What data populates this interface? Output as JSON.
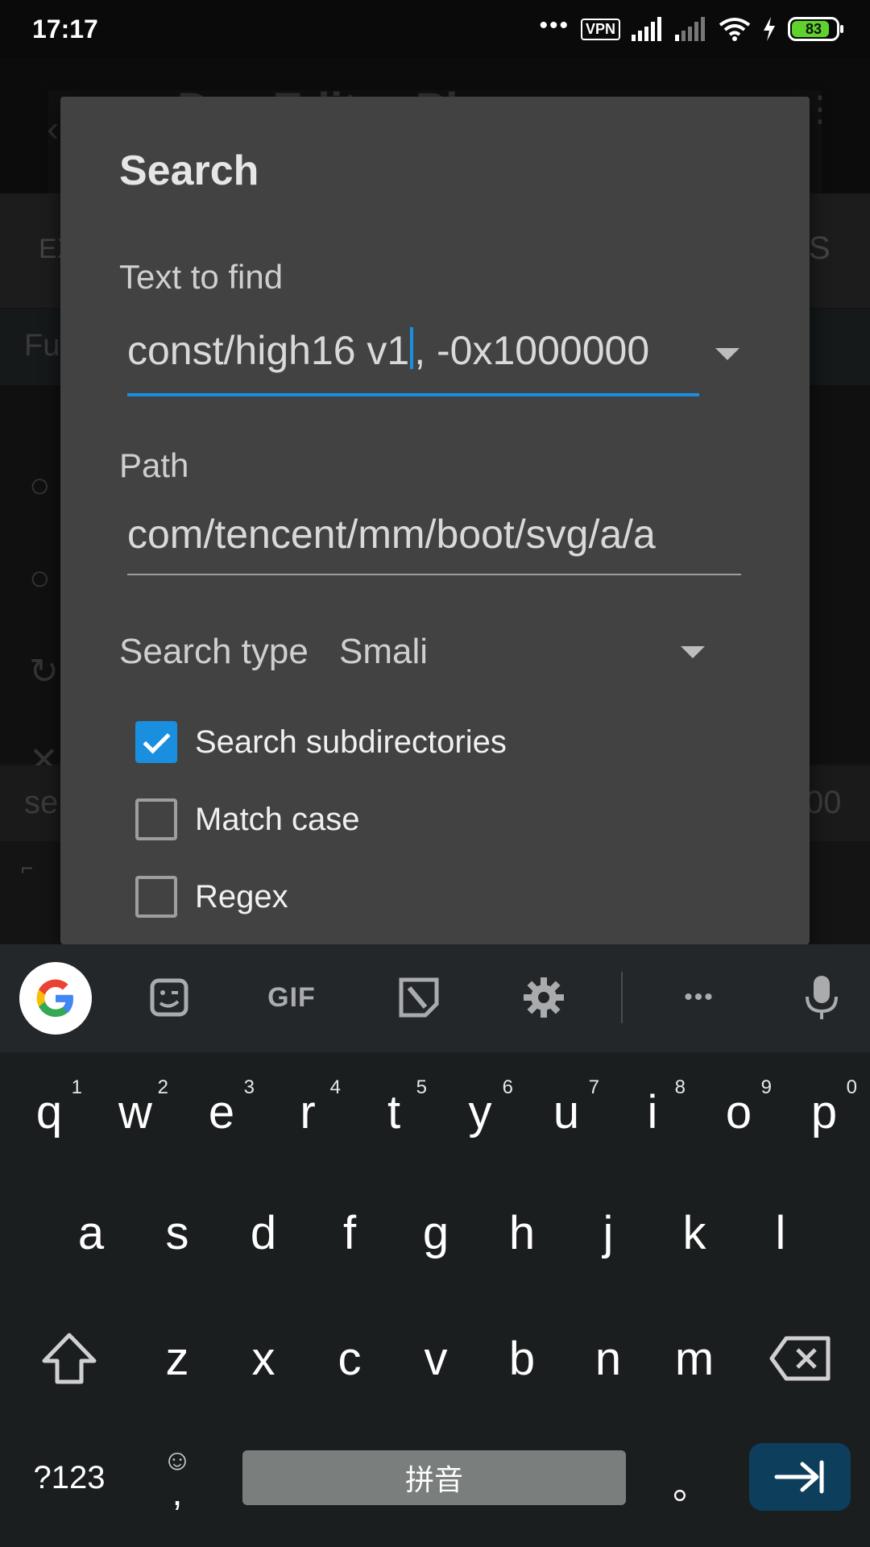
{
  "status_bar": {
    "time": "17:17",
    "dots": "•••",
    "vpn": "VPN",
    "battery": "83",
    "battery_color": "#5fd32b"
  },
  "background_app": {
    "title": "Dex Editor Plus",
    "tab_left": "EX",
    "tab_right": "S",
    "filter_text": "Fu",
    "footer_left": "se",
    "footer_right": "00"
  },
  "dialog": {
    "title": "Search",
    "find_label": "Text to find",
    "find_value_before_caret": "const/high16 v1",
    "find_value_after_caret": ", -0x1000000",
    "path_label": "Path",
    "path_value": "com/tencent/mm/boot/svg/a/a",
    "search_type_label": "Search type",
    "search_type_value": "Smali",
    "checkboxes": [
      {
        "label": "Search subdirectories",
        "checked": true
      },
      {
        "label": "Match case",
        "checked": false
      },
      {
        "label": "Regex",
        "checked": false
      }
    ],
    "accent_color": "#1a8fe0"
  },
  "keyboard": {
    "toolbar_icons": [
      "google-icon",
      "sticker-icon",
      "gif-icon",
      "clipboard-icon",
      "settings-icon",
      "more-icon",
      "microphone-icon"
    ],
    "gif_label": "GIF",
    "more_label": "•••",
    "row1": [
      {
        "key": "q",
        "hint": "1"
      },
      {
        "key": "w",
        "hint": "2"
      },
      {
        "key": "e",
        "hint": "3"
      },
      {
        "key": "r",
        "hint": "4"
      },
      {
        "key": "t",
        "hint": "5"
      },
      {
        "key": "y",
        "hint": "6"
      },
      {
        "key": "u",
        "hint": "7"
      },
      {
        "key": "i",
        "hint": "8"
      },
      {
        "key": "o",
        "hint": "9"
      },
      {
        "key": "p",
        "hint": "0"
      }
    ],
    "row2": [
      "a",
      "s",
      "d",
      "f",
      "g",
      "h",
      "j",
      "k",
      "l"
    ],
    "row3": [
      "z",
      "x",
      "c",
      "v",
      "b",
      "n",
      "m"
    ],
    "symbols_label": "?123",
    "emoji_label": "☺",
    "comma_label": ",",
    "space_label": "拼音",
    "period_label": "。",
    "enter_color": "#0d3e5c"
  }
}
